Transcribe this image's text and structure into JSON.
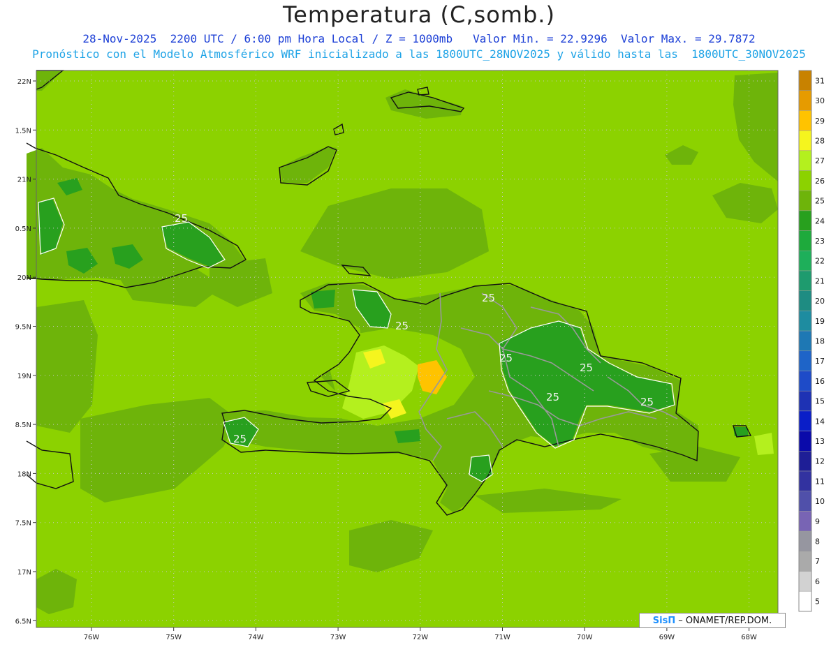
{
  "header": {
    "title": "Temperatura (C,somb.)",
    "line1": "28-Nov-2025  2200 UTC / 6:00 pm Hora Local / Z = 1000mb   Valor Min. = 22.9296  Valor Max. = 29.7872",
    "line2": "Pronóstico con el Modelo Atmosférico WRF inicializado a las 1800UTC_28NOV2025 y válido hasta las  1800UTC_30NOV2025"
  },
  "axes": {
    "lat_labels": [
      "22N",
      "1.5N",
      "21N",
      "0.5N",
      "20N",
      "9.5N",
      "19N",
      "8.5N",
      "18N",
      "7.5N",
      "17N",
      "6.5N"
    ],
    "lon_labels": [
      "76W",
      "75W",
      "74W",
      "73W",
      "72W",
      "71W",
      "70W",
      "69W",
      "68W"
    ]
  },
  "colorbar": {
    "levels": [
      "31",
      "30",
      "29",
      "28",
      "27",
      "26",
      "25",
      "24",
      "23",
      "22",
      "21",
      "20",
      "19",
      "18",
      "17",
      "16",
      "15",
      "14",
      "13",
      "12",
      "11",
      "10",
      "9",
      "8",
      "7",
      "6",
      "5"
    ],
    "colors": [
      "#c88200",
      "#e69b00",
      "#ffc300",
      "#f5f51e",
      "#b4f01e",
      "#8cd200",
      "#6eb40a",
      "#28a01e",
      "#1eaa3c",
      "#1eaf5a",
      "#1e9b6e",
      "#1e8c82",
      "#1e8ca0",
      "#1e78b4",
      "#1e64c8",
      "#1e4bc8",
      "#1e32b4",
      "#0a1ec8",
      "#0a0aaa",
      "#1e1e96",
      "#3232a0",
      "#5050aa",
      "#7864b4",
      "#9696a0",
      "#aaaaaa",
      "#d2d2d2",
      "#ffffff"
    ]
  },
  "contour_labels": [
    {
      "text": "25"
    },
    {
      "text": "25"
    },
    {
      "text": "25"
    },
    {
      "text": "25"
    },
    {
      "text": "25"
    },
    {
      "text": "25"
    },
    {
      "text": "25"
    },
    {
      "text": "25"
    }
  ],
  "credit": {
    "logo": "SisΠ",
    "text": "– ONAMET/REP.DOM."
  }
}
